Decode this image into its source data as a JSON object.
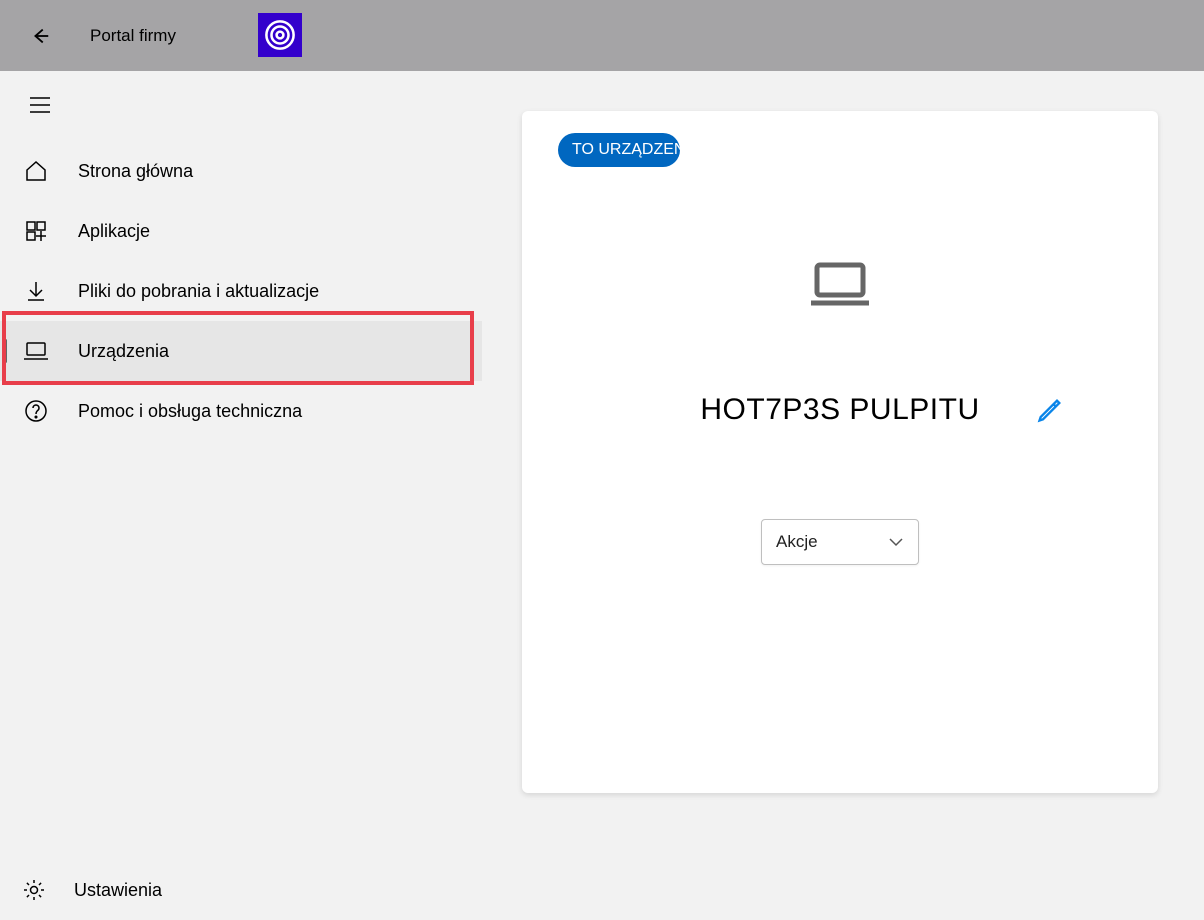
{
  "header": {
    "title": "Portal firmy"
  },
  "sidebar": {
    "items": [
      {
        "label": "Strona główna"
      },
      {
        "label": "Aplikacje"
      },
      {
        "label": "Pliki do pobrania i aktualizacje"
      },
      {
        "label": "Urządzenia"
      },
      {
        "label": "Pomoc i obsługa techniczna"
      }
    ],
    "settings_label": "Ustawienia"
  },
  "device": {
    "badge": "TO URZĄDZENI",
    "name": "HOT7P3S PULPITU",
    "actions_label": "Akcje"
  },
  "colors": {
    "accent": "#0067c0",
    "highlight": "#e83e4a",
    "logo_bg": "#3300cc"
  }
}
